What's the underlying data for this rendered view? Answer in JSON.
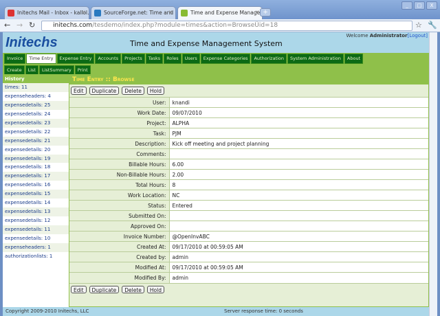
{
  "browser": {
    "tabs": [
      {
        "label": "Initechs Mail - Inbox - kallol...",
        "color": "#d33"
      },
      {
        "label": "SourceForge.net: Time and ...",
        "color": "#2a7ac0"
      },
      {
        "label": "Time and Expense Manage...",
        "color": "#8b3"
      }
    ],
    "url_host": "initechs.com",
    "url_path": "/tesdemo/index.php?module=times&action=BrowseÜid=18"
  },
  "header": {
    "logo": "Initechs",
    "title": "Time and Expense Management System",
    "welcome": "Welcome ",
    "user": "Administrator",
    "logout": "[Logout]"
  },
  "menu": [
    "Invoice",
    "Time Entry",
    "Expense Entry",
    "Accounts",
    "Projects",
    "Tasks",
    "Roles",
    "Users",
    "Expense Categories",
    "Authorization",
    "System Administration",
    "About"
  ],
  "submenu": [
    "Create",
    "List",
    "ListSummary",
    "Print"
  ],
  "history": {
    "title": "History",
    "items": [
      "times: 11",
      "expenseheaders: 4",
      "expensedetails: 25",
      "expensedetails: 24",
      "expensedetails: 23",
      "expensedetails: 22",
      "expensedetails: 21",
      "expensedetails: 20",
      "expensedetails: 19",
      "expensedetails: 18",
      "expensedetails: 17",
      "expensedetails: 16",
      "expensedetails: 15",
      "expensedetails: 14",
      "expensedetails: 13",
      "expensedetails: 12",
      "expensedetails: 11",
      "expensedetails: 10",
      "expenseheaders: 1",
      "authorizationlists: 1"
    ]
  },
  "main": {
    "title": "Time Entry :: Browse",
    "buttons": [
      "Edit",
      "Duplicate",
      "Delete",
      "Hold"
    ],
    "fields": [
      [
        "User:",
        "knandi"
      ],
      [
        "Work Date:",
        "09/07/2010"
      ],
      [
        "Project:",
        "ALPHA"
      ],
      [
        "Task:",
        "PJM"
      ],
      [
        "Description:",
        "Kick off meeting and project planning"
      ],
      [
        "Comments:",
        ""
      ],
      [
        "Billable Hours:",
        "6.00"
      ],
      [
        "Non-Billable Hours:",
        "2.00"
      ],
      [
        "Total Hours:",
        "8"
      ],
      [
        "Work Location:",
        "NC"
      ],
      [
        "Status:",
        "Entered"
      ],
      [
        "Submitted On:",
        ""
      ],
      [
        "Approved On:",
        ""
      ],
      [
        "Invoice Number:",
        "@OpenInvABC"
      ],
      [
        "Created At:",
        "09/17/2010 at 00:59:05 AM"
      ],
      [
        "Created by:",
        "admin"
      ],
      [
        "Modified At:",
        "09/17/2010 at 00:59:05 AM"
      ],
      [
        "Modified By:",
        "admin"
      ]
    ]
  },
  "footer": {
    "copyright": "Copyright 2009-2010 Initechs, LLC",
    "response": "Server response time: 0 seconds"
  }
}
